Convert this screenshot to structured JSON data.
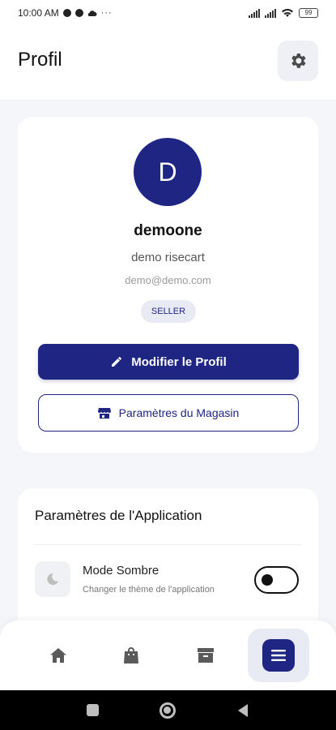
{
  "status_bar": {
    "time": "10:00 AM",
    "more": "···",
    "battery": "99"
  },
  "header": {
    "title": "Profil",
    "settings_icon": "gear-icon"
  },
  "profile": {
    "avatar_initial": "D",
    "username": "demoone",
    "full_name": "demo risecart",
    "email": "demo@demo.com",
    "role": "SELLER",
    "edit_button": "Modifier le Profil",
    "store_settings_button": "Paramètres du Magasin"
  },
  "app_settings": {
    "title": "Paramètres de l'Application",
    "items": [
      {
        "label": "Mode Sombre",
        "description": "Changer le thème de l'application",
        "icon": "moon-icon",
        "enabled": false
      }
    ]
  },
  "bottom_nav": {
    "items": [
      {
        "icon": "home-icon",
        "active": false
      },
      {
        "icon": "shopping-bag-icon",
        "active": false
      },
      {
        "icon": "archive-box-icon",
        "active": false
      },
      {
        "icon": "menu-icon",
        "active": true
      }
    ]
  },
  "colors": {
    "primary": "#1f2582",
    "background": "#f5f6fa",
    "badge_bg": "#e8eaf4"
  }
}
